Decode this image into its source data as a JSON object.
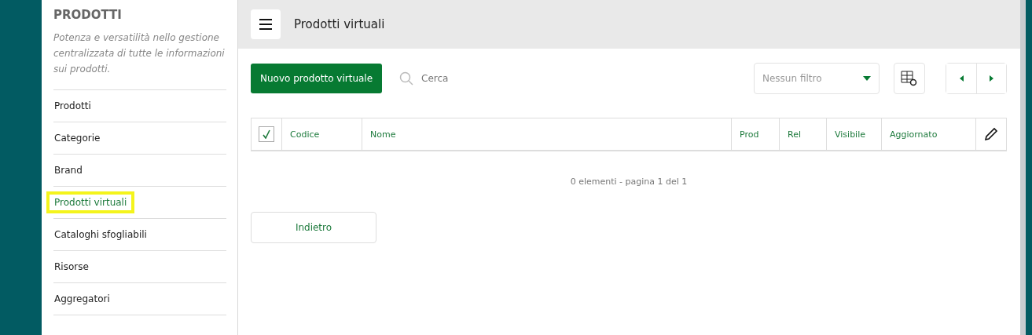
{
  "sidebar": {
    "title": "PRODOTTI",
    "description": "Potenza e versatilità nello gestione centralizzata di tutte le informazioni sui prodotti.",
    "items": [
      {
        "label": "Prodotti",
        "selected": false
      },
      {
        "label": "Categorie",
        "selected": false
      },
      {
        "label": "Brand",
        "selected": false
      },
      {
        "label": "Prodotti virtuali",
        "selected": true
      },
      {
        "label": "Cataloghi sfogliabili",
        "selected": false
      },
      {
        "label": "Risorse",
        "selected": false
      },
      {
        "label": "Aggregatori",
        "selected": false
      }
    ]
  },
  "header": {
    "title": "Prodotti virtuali"
  },
  "toolbar": {
    "new_button": "Nuovo prodotto virtuale",
    "search": {
      "placeholder": "Cerca"
    },
    "filter": {
      "placeholder": "Nessun filtro"
    }
  },
  "table": {
    "select_all": {
      "checked": true
    },
    "columns": [
      "Codice",
      "Nome",
      "Prod",
      "Rel",
      "Visibile",
      "Aggiornato"
    ]
  },
  "pagination": "0 elementi - pagina 1 del 1",
  "back_button": "Indietro"
}
